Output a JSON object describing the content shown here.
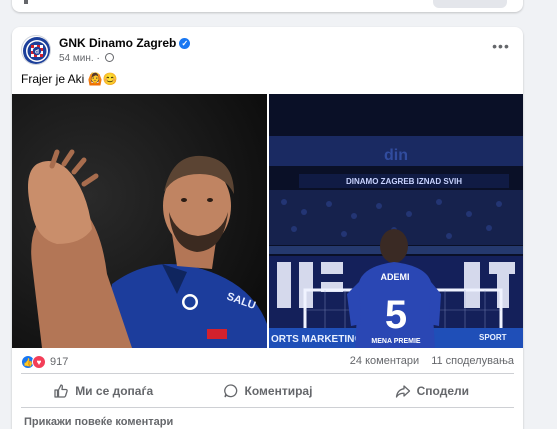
{
  "post": {
    "page_name": "GNK Dinamo Zagreb",
    "time": "54 мин.",
    "text": "Frajer je Aki 🙆😊",
    "more_icon": "more-horizontal-icon",
    "photos": [
      {
        "icon": "player-applauding-photo"
      },
      {
        "icon": "player-facing-stadium-photo",
        "stand_banner": "DINAMO ZAGREB IZNAD SVIH",
        "jersey_name": "ADEMI",
        "jersey_number": "5",
        "jersey_sponsor": "MENA PREMIE",
        "board_left": "ORTS MARKETING",
        "board_right": "SPORT"
      }
    ],
    "reactions": {
      "icons": [
        "like-icon",
        "love-icon"
      ],
      "count": "917"
    },
    "comments_count": "24 коментари",
    "shares_count": "11 споделувања",
    "actions": {
      "like": "Ми се допаѓа",
      "comment": "Коментирај",
      "share": "Сподели"
    },
    "more_comments": "Прикажи повеќе коментари"
  },
  "colors": {
    "accent": "#1877f2",
    "love": "#f33e58",
    "dinamo_blue": "#1c3f9a"
  }
}
